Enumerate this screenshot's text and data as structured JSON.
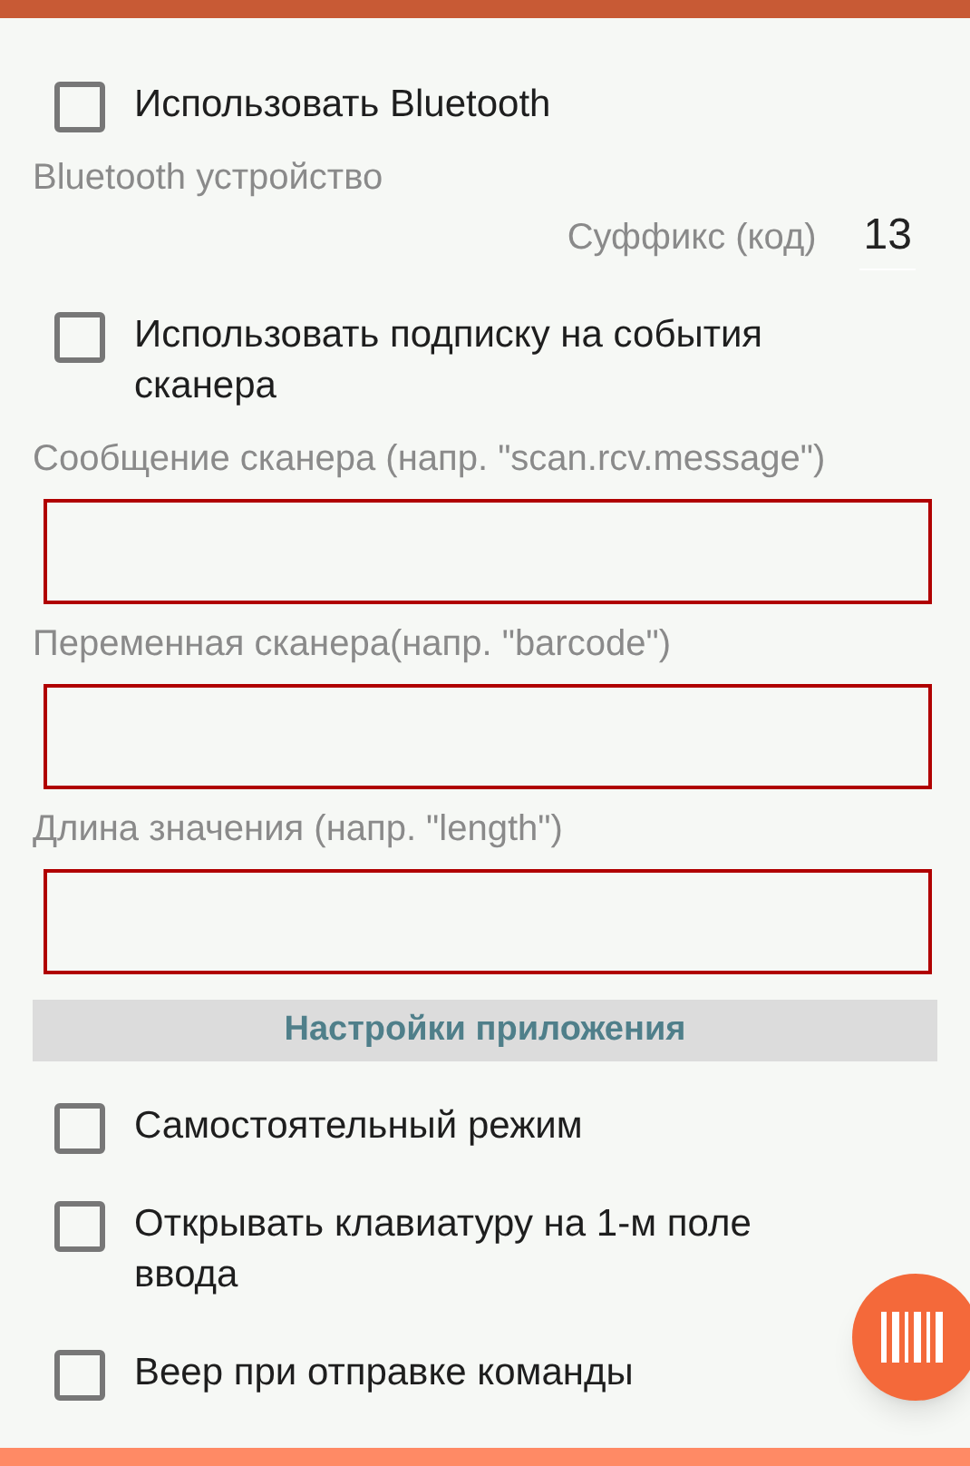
{
  "settings": [
    {
      "kind": "checkbox",
      "label": "Использовать Bluetooth",
      "checked": false
    },
    {
      "kind": "label",
      "text": "Bluetooth устройство"
    },
    {
      "kind": "suffix",
      "label": "Суффикс (код)",
      "value": "13"
    },
    {
      "kind": "checkbox",
      "label": "Использовать подписку на события сканера",
      "checked": false
    },
    {
      "kind": "label",
      "text": "Сообщение сканера (напр. \"scan.rcv.message\")"
    },
    {
      "kind": "field"
    },
    {
      "kind": "label",
      "text": "Переменная сканера(напр. \"barcode\")"
    },
    {
      "kind": "field"
    },
    {
      "kind": "label",
      "text": "Длина значения (напр. \"length\")"
    },
    {
      "kind": "field"
    },
    {
      "kind": "header",
      "text": "Настройки приложения"
    },
    {
      "kind": "checkbox",
      "label": "Самостоятельный режим",
      "checked": false
    },
    {
      "kind": "checkbox",
      "label": "Открывать клавиатуру на 1-м поле ввода",
      "checked": false
    },
    {
      "kind": "checkbox",
      "label": "Веер при отправке команды",
      "checked": false
    }
  ]
}
